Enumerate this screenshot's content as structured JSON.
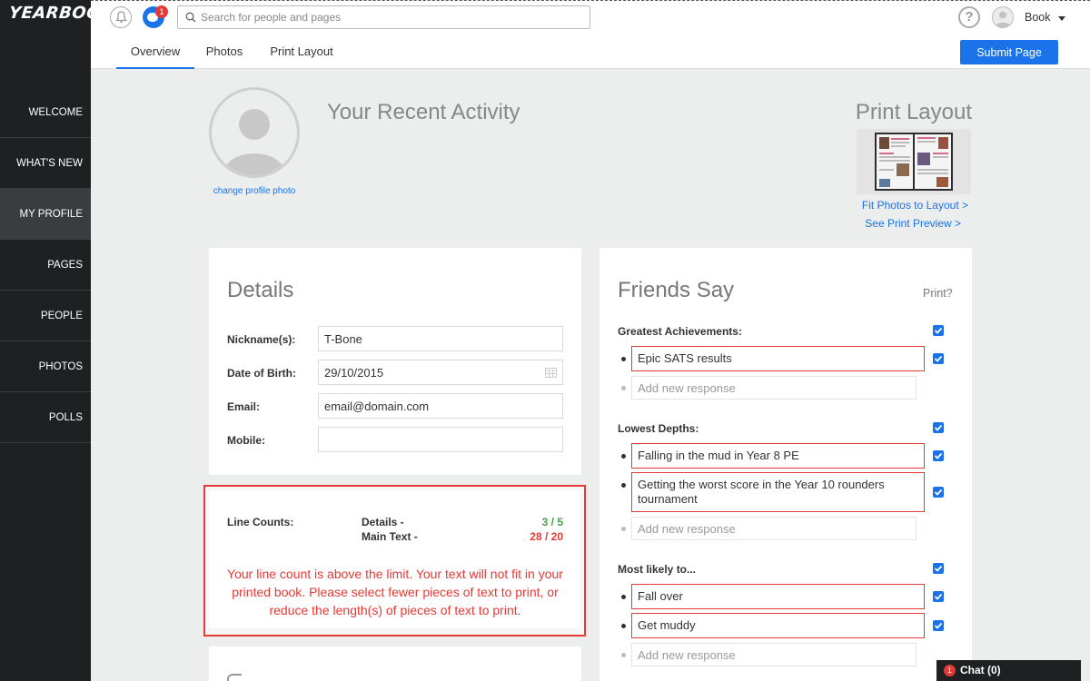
{
  "app": {
    "logo": "YEARBOOK"
  },
  "sidebar": {
    "items": [
      {
        "label": "WELCOME"
      },
      {
        "label": "WHAT'S NEW"
      },
      {
        "label": "MY PROFILE",
        "active": true
      },
      {
        "label": "PAGES"
      },
      {
        "label": "PEOPLE"
      },
      {
        "label": "PHOTOS"
      },
      {
        "label": "POLLS"
      }
    ]
  },
  "topbar": {
    "notification_count": "1",
    "search_placeholder": "Search for people and pages",
    "help_symbol": "?",
    "user_menu_label": "Book"
  },
  "tabs": [
    {
      "label": "Overview",
      "active": true
    },
    {
      "label": "Photos"
    },
    {
      "label": "Print Layout"
    }
  ],
  "submit_button": "Submit Page",
  "profile": {
    "change_photo_label": "change profile photo",
    "activity_heading": "Your Recent Activity",
    "print_layout_heading": "Print Layout",
    "fit_photos_link": "Fit Photos to Layout >",
    "print_preview_link": "See Print Preview >"
  },
  "details": {
    "title": "Details",
    "fields": [
      {
        "label": "Nickname(s):",
        "value": "T-Bone"
      },
      {
        "label": "Date of Birth:",
        "value": "29/10/2015"
      },
      {
        "label": "Email:",
        "value": "email@domain.com"
      },
      {
        "label": "Mobile:",
        "value": ""
      }
    ]
  },
  "line_counts": {
    "label": "Line Counts:",
    "details_label": "Details -",
    "details_value": "3 / 5",
    "main_text_label": "Main Text -",
    "main_text_value": "28 / 20",
    "ok_color": "#43a047",
    "error_color": "#e53935",
    "warning": "Your line count is above the limit. Your text will not fit in your printed book. Please select fewer pieces of text to print, or reduce the length(s) of pieces of text to print."
  },
  "friends_say": {
    "title": "Friends Say",
    "print_label": "Print?",
    "new_response_placeholder": "Add new response",
    "sections": [
      {
        "label": "Greatest Achievements:",
        "checked": true,
        "responses": [
          {
            "text": "Epic SATS results",
            "checked": true
          }
        ]
      },
      {
        "label": "Lowest Depths:",
        "checked": true,
        "responses": [
          {
            "text": "Falling in the mud in Year 8 PE",
            "checked": true
          },
          {
            "text": "Getting the worst score in the Year 10 rounders tournament",
            "checked": true
          }
        ]
      },
      {
        "label": "Most likely to...",
        "checked": true,
        "responses": [
          {
            "text": "Fall over",
            "checked": true
          },
          {
            "text": "Get muddy",
            "checked": true
          }
        ]
      }
    ]
  },
  "chat": {
    "badge": "1",
    "label": "Chat (0)"
  },
  "colors": {
    "accent": "#1a73e8",
    "sidebar_bg": "#1e2022",
    "error": "#e53935",
    "ok": "#43a047"
  }
}
